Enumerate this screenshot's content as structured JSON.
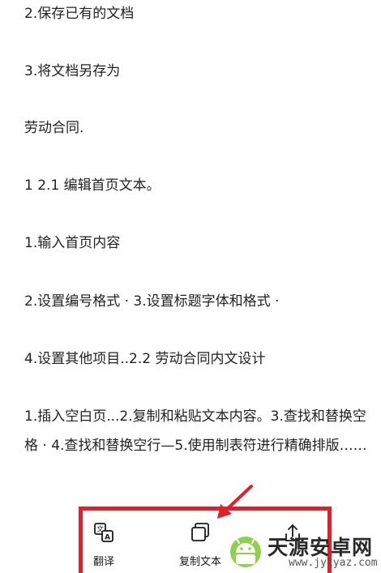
{
  "document": {
    "paragraphs": [
      "2.保存已有的文档",
      "3.将文档另存为",
      "劳动合同.",
      "1 2.1 编辑首页文本。",
      "1.输入首页内容",
      "2.设置编号格式 · 3.设置标题字体和格式 ·",
      "4.设置其他项目..2.2 劳动合同内文设计",
      "1.插入空白页...2.复制和粘贴文本内容。3.查找和替换空格 · 4.查找和替换空行—5.使用制表符进行精确排版……"
    ]
  },
  "toolbar": {
    "translate_label": "翻译",
    "copy_label": "复制文本",
    "highlight_color": "#e0202a"
  },
  "watermark": {
    "name": "天源安卓网",
    "url": "www.jytyaz.com"
  }
}
